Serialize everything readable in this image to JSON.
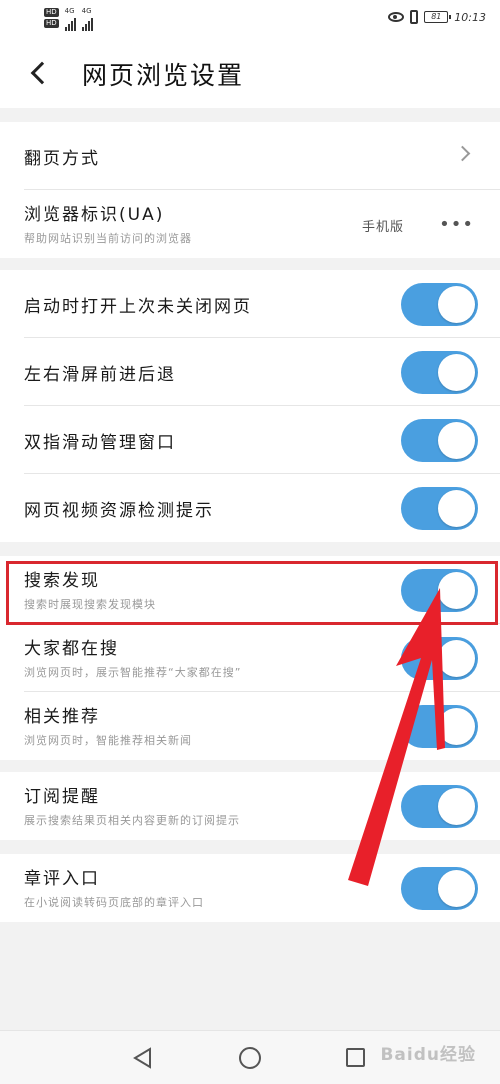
{
  "status_bar": {
    "hd1": "HD",
    "hd2": "HD",
    "net1": "4G",
    "net2": "4G",
    "time": "10:13",
    "battery_level": "81"
  },
  "header": {
    "title": "网页浏览设置"
  },
  "group1": {
    "page_turn_label": "翻页方式",
    "ua_label": "浏览器标识(UA)",
    "ua_sub": "帮助网站识别当前访问的浏览器",
    "ua_value": "手机版",
    "ua_more": "•••"
  },
  "group2": {
    "items": [
      {
        "label": "启动时打开上次未关闭网页",
        "enabled": true
      },
      {
        "label": "左右滑屏前进后退",
        "enabled": true
      },
      {
        "label": "双指滑动管理窗口",
        "enabled": true
      },
      {
        "label": "网页视频资源检测提示",
        "enabled": true
      }
    ]
  },
  "group3": {
    "items": [
      {
        "label": "搜索发现",
        "sub": "搜索时展现搜索发现模块",
        "enabled": true
      },
      {
        "label": "大家都在搜",
        "sub": "浏览网页时，展示智能推荐“大家都在搜”",
        "enabled": true
      },
      {
        "label": "相关推荐",
        "sub": "浏览网页时，智能推荐相关新闻",
        "enabled": true
      }
    ]
  },
  "group4": {
    "label": "订阅提醒",
    "sub": "展示搜索结果页相关内容更新的订阅提示",
    "enabled": true
  },
  "group5": {
    "label": "章评入口",
    "sub": "在小说阅读转码页底部的章评入口",
    "enabled": true
  },
  "watermark": "Baidu经验",
  "colors": {
    "toggle_on": "#4a9fe0",
    "highlight": "#d9282f",
    "arrow": "#e8202a"
  }
}
